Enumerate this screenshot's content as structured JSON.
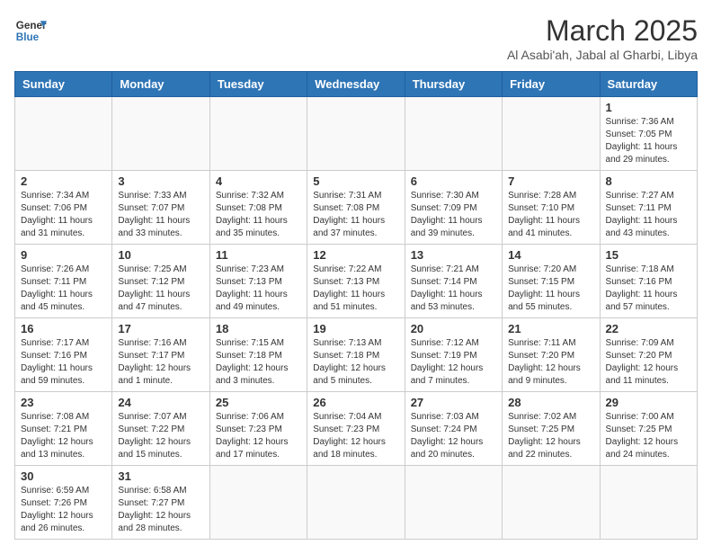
{
  "logo": {
    "line1": "General",
    "line2": "Blue"
  },
  "title": "March 2025",
  "subtitle": "Al Asabi'ah, Jabal al Gharbi, Libya",
  "days_of_week": [
    "Sunday",
    "Monday",
    "Tuesday",
    "Wednesday",
    "Thursday",
    "Friday",
    "Saturday"
  ],
  "weeks": [
    [
      {
        "day": "",
        "info": ""
      },
      {
        "day": "",
        "info": ""
      },
      {
        "day": "",
        "info": ""
      },
      {
        "day": "",
        "info": ""
      },
      {
        "day": "",
        "info": ""
      },
      {
        "day": "",
        "info": ""
      },
      {
        "day": "1",
        "info": "Sunrise: 7:36 AM\nSunset: 7:05 PM\nDaylight: 11 hours\nand 29 minutes."
      }
    ],
    [
      {
        "day": "2",
        "info": "Sunrise: 7:34 AM\nSunset: 7:06 PM\nDaylight: 11 hours\nand 31 minutes."
      },
      {
        "day": "3",
        "info": "Sunrise: 7:33 AM\nSunset: 7:07 PM\nDaylight: 11 hours\nand 33 minutes."
      },
      {
        "day": "4",
        "info": "Sunrise: 7:32 AM\nSunset: 7:08 PM\nDaylight: 11 hours\nand 35 minutes."
      },
      {
        "day": "5",
        "info": "Sunrise: 7:31 AM\nSunset: 7:08 PM\nDaylight: 11 hours\nand 37 minutes."
      },
      {
        "day": "6",
        "info": "Sunrise: 7:30 AM\nSunset: 7:09 PM\nDaylight: 11 hours\nand 39 minutes."
      },
      {
        "day": "7",
        "info": "Sunrise: 7:28 AM\nSunset: 7:10 PM\nDaylight: 11 hours\nand 41 minutes."
      },
      {
        "day": "8",
        "info": "Sunrise: 7:27 AM\nSunset: 7:11 PM\nDaylight: 11 hours\nand 43 minutes."
      }
    ],
    [
      {
        "day": "9",
        "info": "Sunrise: 7:26 AM\nSunset: 7:11 PM\nDaylight: 11 hours\nand 45 minutes."
      },
      {
        "day": "10",
        "info": "Sunrise: 7:25 AM\nSunset: 7:12 PM\nDaylight: 11 hours\nand 47 minutes."
      },
      {
        "day": "11",
        "info": "Sunrise: 7:23 AM\nSunset: 7:13 PM\nDaylight: 11 hours\nand 49 minutes."
      },
      {
        "day": "12",
        "info": "Sunrise: 7:22 AM\nSunset: 7:13 PM\nDaylight: 11 hours\nand 51 minutes."
      },
      {
        "day": "13",
        "info": "Sunrise: 7:21 AM\nSunset: 7:14 PM\nDaylight: 11 hours\nand 53 minutes."
      },
      {
        "day": "14",
        "info": "Sunrise: 7:20 AM\nSunset: 7:15 PM\nDaylight: 11 hours\nand 55 minutes."
      },
      {
        "day": "15",
        "info": "Sunrise: 7:18 AM\nSunset: 7:16 PM\nDaylight: 11 hours\nand 57 minutes."
      }
    ],
    [
      {
        "day": "16",
        "info": "Sunrise: 7:17 AM\nSunset: 7:16 PM\nDaylight: 11 hours\nand 59 minutes."
      },
      {
        "day": "17",
        "info": "Sunrise: 7:16 AM\nSunset: 7:17 PM\nDaylight: 12 hours\nand 1 minute."
      },
      {
        "day": "18",
        "info": "Sunrise: 7:15 AM\nSunset: 7:18 PM\nDaylight: 12 hours\nand 3 minutes."
      },
      {
        "day": "19",
        "info": "Sunrise: 7:13 AM\nSunset: 7:18 PM\nDaylight: 12 hours\nand 5 minutes."
      },
      {
        "day": "20",
        "info": "Sunrise: 7:12 AM\nSunset: 7:19 PM\nDaylight: 12 hours\nand 7 minutes."
      },
      {
        "day": "21",
        "info": "Sunrise: 7:11 AM\nSunset: 7:20 PM\nDaylight: 12 hours\nand 9 minutes."
      },
      {
        "day": "22",
        "info": "Sunrise: 7:09 AM\nSunset: 7:20 PM\nDaylight: 12 hours\nand 11 minutes."
      }
    ],
    [
      {
        "day": "23",
        "info": "Sunrise: 7:08 AM\nSunset: 7:21 PM\nDaylight: 12 hours\nand 13 minutes."
      },
      {
        "day": "24",
        "info": "Sunrise: 7:07 AM\nSunset: 7:22 PM\nDaylight: 12 hours\nand 15 minutes."
      },
      {
        "day": "25",
        "info": "Sunrise: 7:06 AM\nSunset: 7:23 PM\nDaylight: 12 hours\nand 17 minutes."
      },
      {
        "day": "26",
        "info": "Sunrise: 7:04 AM\nSunset: 7:23 PM\nDaylight: 12 hours\nand 18 minutes."
      },
      {
        "day": "27",
        "info": "Sunrise: 7:03 AM\nSunset: 7:24 PM\nDaylight: 12 hours\nand 20 minutes."
      },
      {
        "day": "28",
        "info": "Sunrise: 7:02 AM\nSunset: 7:25 PM\nDaylight: 12 hours\nand 22 minutes."
      },
      {
        "day": "29",
        "info": "Sunrise: 7:00 AM\nSunset: 7:25 PM\nDaylight: 12 hours\nand 24 minutes."
      }
    ],
    [
      {
        "day": "30",
        "info": "Sunrise: 6:59 AM\nSunset: 7:26 PM\nDaylight: 12 hours\nand 26 minutes."
      },
      {
        "day": "31",
        "info": "Sunrise: 6:58 AM\nSunset: 7:27 PM\nDaylight: 12 hours\nand 28 minutes."
      },
      {
        "day": "",
        "info": ""
      },
      {
        "day": "",
        "info": ""
      },
      {
        "day": "",
        "info": ""
      },
      {
        "day": "",
        "info": ""
      },
      {
        "day": "",
        "info": ""
      }
    ]
  ]
}
